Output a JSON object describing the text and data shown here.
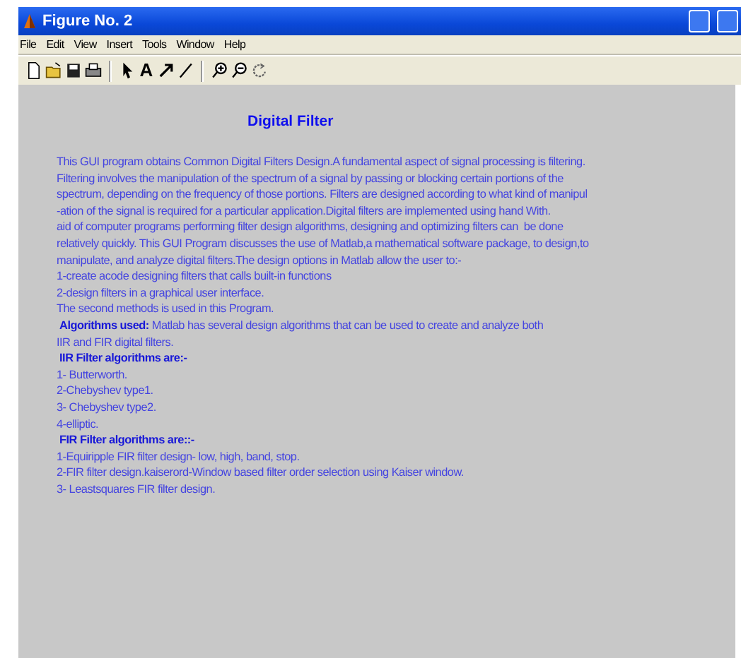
{
  "window": {
    "title": "Figure No. 2"
  },
  "menu": [
    "File",
    "Edit",
    "View",
    "Insert",
    "Tools",
    "Window",
    "Help"
  ],
  "toolbar": [
    {
      "kind": "new"
    },
    {
      "kind": "open"
    },
    {
      "kind": "save"
    },
    {
      "kind": "print"
    },
    {
      "kind": "separator"
    },
    {
      "kind": "pointer"
    },
    {
      "kind": "text",
      "label": "A"
    },
    {
      "kind": "arrow"
    },
    {
      "kind": "line"
    },
    {
      "kind": "separator"
    },
    {
      "kind": "zoom-in"
    },
    {
      "kind": "zoom-out"
    },
    {
      "kind": "rotate"
    }
  ],
  "heading": "Digital Filter",
  "lines": [
    {
      "kind": "text",
      "text": "This GUI program obtains Common Digital Filters Design.A fundamental aspect of signal processing is filtering."
    },
    {
      "kind": "text",
      "text": "Filtering involves the manipulation of the spectrum of a signal by passing or blocking certain portions of the"
    },
    {
      "kind": "text",
      "text": "spectrum, depending on the frequency of those portions. Filters are designed according to what kind of manipul"
    },
    {
      "kind": "text",
      "text": "-ation of the signal is required for a particular application.Digital filters are implemented using hand With."
    },
    {
      "kind": "text",
      "text": "aid of computer programs performing filter design algorithms, designing and optimizing filters can  be done"
    },
    {
      "kind": "text",
      "text": "relatively quickly. This GUI Program discusses the use of Matlab,a mathematical software package, to design,to"
    },
    {
      "kind": "text",
      "text": "manipulate, and analyze digital filters.The design options in Matlab allow the user to:-"
    },
    {
      "kind": "text",
      "text": "1-create acode designing filters that calls built-in functions"
    },
    {
      "kind": "text",
      "text": "2-design filters in a graphical user interface."
    },
    {
      "kind": "text",
      "text": "The second methods is used in this Program."
    },
    {
      "kind": "text",
      "text": " **Algorithms used:** Matlab has several design algorithms that can be used to create and analyze both"
    },
    {
      "kind": "text",
      "text": "IIR and FIR digital filters."
    },
    {
      "kind": "heading",
      "text": " IIR Filter algorithms are:-"
    },
    {
      "kind": "text",
      "text": "1- Butterworth."
    },
    {
      "kind": "text",
      "text": "2-Chebyshev type1."
    },
    {
      "kind": "text",
      "text": "3- Chebyshev type2."
    },
    {
      "kind": "text",
      "text": "4-elliptic."
    },
    {
      "kind": "heading",
      "text": " FIR Filter algorithms are::-"
    },
    {
      "kind": "text",
      "text": "1-Equiripple FIR filter design- low, high, band, stop."
    },
    {
      "kind": "text",
      "text": "2-FIR filter design.kaiserord-Window based filter order selection using Kaiser window."
    },
    {
      "kind": "text",
      "text": "3- Leastsquares FIR filter design."
    }
  ]
}
